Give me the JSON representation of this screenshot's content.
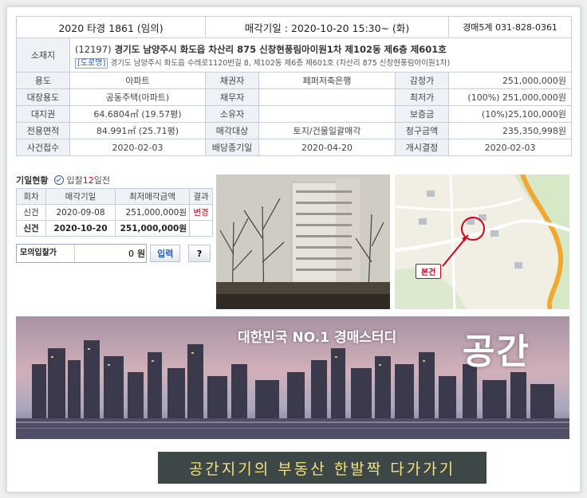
{
  "header": {
    "case_no": "2020 타경 1861 (임의)",
    "sale_date": "매각기일 : 2020-10-20 15:30~ (화)",
    "court_contact": "경매5계 031-828-0361"
  },
  "location": {
    "label": "소재지",
    "zip": "(12197)",
    "address": "경기도 남양주시 화도읍 차산리 875 신창현풍림아이원1차 제102동 제6층 제601호",
    "road_tag": "[도로명]",
    "road_address": "경기도 남양주시 화도읍 수레로1120번길 8, 제102동 제6층 제601호 (차산리 875 신창현풍림아이원1차)"
  },
  "rows": [
    {
      "l1": "용도",
      "v1": "아파트",
      "l2": "채권자",
      "v2": "페퍼저축은행",
      "l3": "감정가",
      "v3": "251,000,000원"
    },
    {
      "l1": "대장용도",
      "v1": "공동주택(아파트)",
      "l2": "채무자",
      "v2": "",
      "l3": "최저가",
      "v3": "(100%) 251,000,000원"
    },
    {
      "l1": "대지권",
      "v1": "64.6804㎡ (19.57평)",
      "l2": "소유자",
      "v2": "",
      "l3": "보증금",
      "v3": "(10%)25,100,000원"
    },
    {
      "l1": "전용면적",
      "v1": "84.991㎡ (25.71평)",
      "l2": "매각대상",
      "v2": "토지/건물일괄매각",
      "l3": "청구금액",
      "v3": "235,350,998원"
    },
    {
      "l1": "사건접수",
      "v1": "2020-02-03",
      "l2": "배당종기일",
      "v2": "2020-04-20",
      "l3": "개시결정",
      "v3": "2020-02-03"
    }
  ],
  "schedule": {
    "title": "기일현황",
    "badge_prefix": "입찰",
    "badge_num": "12",
    "badge_suffix": "일전",
    "headers": [
      "회차",
      "매각기일",
      "최저매각금액",
      "결과"
    ],
    "rows": [
      {
        "round": "신건",
        "date": "2020-09-08",
        "price": "251,000,000원",
        "result": "변경"
      },
      {
        "round": "신건",
        "date": "2020-10-20",
        "price": "251,000,000원",
        "result": ""
      }
    ]
  },
  "mock_bid": {
    "label": "모의입찰가",
    "value": "0",
    "unit": "원",
    "input_button": "입력",
    "help_button": "?"
  },
  "map": {
    "marker_label": "본건"
  },
  "banner": {
    "slogan": "대한민국 NO.1 경매스터디",
    "brand": "공간"
  },
  "footer": {
    "text": "공간지기의 부동산 한발짝 다가가기"
  },
  "colors": {
    "accent_red": "#d0021b",
    "accent_blue": "#2a5db0",
    "header_bg": "#eef1f6",
    "footer_bg": "#3e4747",
    "footer_text": "#f3e27b"
  }
}
